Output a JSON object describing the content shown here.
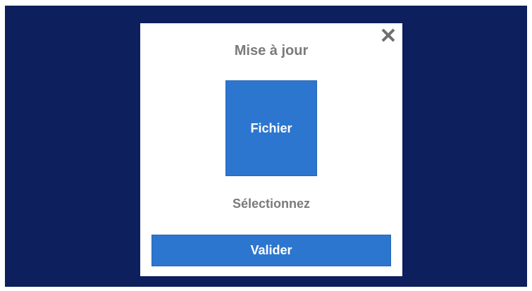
{
  "dialog": {
    "title": "Mise à jour",
    "file_button_label": "Fichier",
    "status_text": "Sélectionnez",
    "validate_label": "Valider",
    "close_icon": "close-icon"
  },
  "colors": {
    "backdrop": "#0d1f5c",
    "dialog_bg": "#ffffff",
    "accent": "#2d76d0",
    "muted_text": "#7a7a7a",
    "close_icon": "#6f6f6f"
  }
}
